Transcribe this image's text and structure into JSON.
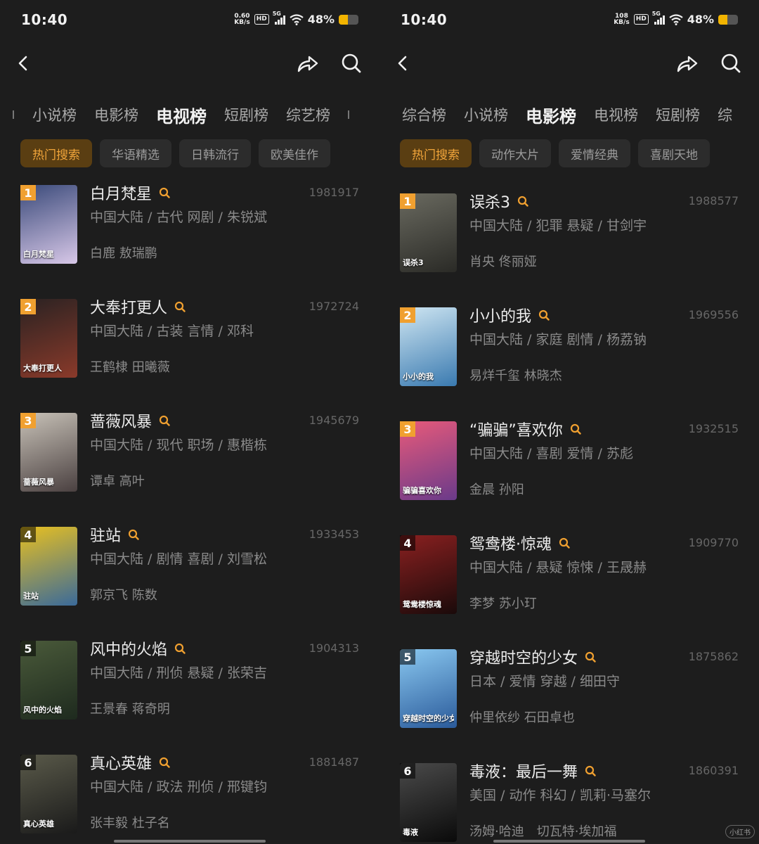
{
  "colors": {
    "accent": "#f0a030",
    "background": "#1d1d1d",
    "chip_active_bg": "#5a3e12"
  },
  "left": {
    "status": {
      "time": "10:40",
      "speed_value": "0.60",
      "speed_unit": "KB/s",
      "hd": "HD",
      "network": "5G",
      "battery_pct": "48%",
      "battery_level": 0.48
    },
    "tabs": [
      {
        "label": "小说榜",
        "active": false
      },
      {
        "label": "电影榜",
        "active": false
      },
      {
        "label": "电视榜",
        "active": true
      },
      {
        "label": "短剧榜",
        "active": false
      },
      {
        "label": "综艺榜",
        "active": false
      }
    ],
    "subtabs": [
      {
        "label": "热门搜索",
        "active": true
      },
      {
        "label": "华语精选",
        "active": false
      },
      {
        "label": "日韩流行",
        "active": false
      },
      {
        "label": "欧美佳作",
        "active": false
      }
    ],
    "items": [
      {
        "rank": "1",
        "title": "白月梵星",
        "score": "1981917",
        "meta": "中国大陆 / 古代 网剧 / 朱锐斌",
        "cast": "白鹿 敖瑞鹏",
        "poster_text": "白月梵星",
        "c1": "#3a4a7a",
        "c2": "#d8c8e8"
      },
      {
        "rank": "2",
        "title": "大奉打更人",
        "score": "1972724",
        "meta": "中国大陆 / 古装 言情 / 邓科",
        "cast": "王鹤棣 田曦薇",
        "poster_text": "大奉打更人",
        "c1": "#2a2222",
        "c2": "#8a3a2a"
      },
      {
        "rank": "3",
        "title": "蔷薇风暴",
        "score": "1945679",
        "meta": "中国大陆 / 现代 职场 / 惠楷栋",
        "cast": "谭卓 高叶",
        "poster_text": "蔷薇风暴",
        "c1": "#c8c2b8",
        "c2": "#4a4040"
      },
      {
        "rank": "4",
        "title": "驻站",
        "score": "1933453",
        "meta": "中国大陆 / 剧情 喜剧 / 刘雪松",
        "cast": "郭京飞 陈数",
        "poster_text": "驻站",
        "c1": "#e8c020",
        "c2": "#3a6a9a"
      },
      {
        "rank": "5",
        "title": "风中的火焰",
        "score": "1904313",
        "meta": "中国大陆 / 刑侦 悬疑 / 张荣吉",
        "cast": "王景春 蒋奇明",
        "poster_text": "风中的火焰",
        "c1": "#4a5a3a",
        "c2": "#1e2a1e"
      },
      {
        "rank": "6",
        "title": "真心英雄",
        "score": "1881487",
        "meta": "中国大陆 / 政法 刑侦 / 邢键钧",
        "cast": "张丰毅 杜子名",
        "poster_text": "真心英雄",
        "c1": "#5a5a4a",
        "c2": "#1a1a1a"
      }
    ]
  },
  "right": {
    "status": {
      "time": "10:40",
      "speed_value": "108",
      "speed_unit": "KB/s",
      "hd": "HD",
      "network": "5G",
      "battery_pct": "48%",
      "battery_level": 0.48
    },
    "tabs": [
      {
        "label": "综合榜",
        "active": false
      },
      {
        "label": "小说榜",
        "active": false
      },
      {
        "label": "电影榜",
        "active": true
      },
      {
        "label": "电视榜",
        "active": false
      },
      {
        "label": "短剧榜",
        "active": false
      },
      {
        "label": "综",
        "active": false
      }
    ],
    "subtabs": [
      {
        "label": "热门搜索",
        "active": true
      },
      {
        "label": "动作大片",
        "active": false
      },
      {
        "label": "爱情经典",
        "active": false
      },
      {
        "label": "喜剧天地",
        "active": false
      }
    ],
    "items": [
      {
        "rank": "1",
        "title": "误杀3",
        "score": "1988577",
        "meta": "中国大陆 / 犯罪 悬疑 / 甘剑宇",
        "cast": "肖央 佟丽娅",
        "poster_text": "误杀3",
        "c1": "#6a6a60",
        "c2": "#2a2a26"
      },
      {
        "rank": "2",
        "title": "小小的我",
        "score": "1969556",
        "meta": "中国大陆 / 家庭 剧情 / 杨荔钠",
        "cast": "易烊千玺 林晓杰",
        "poster_text": "小小的我",
        "c1": "#cfe6f2",
        "c2": "#3a7ab0"
      },
      {
        "rank": "3",
        "title": "“骗骗”喜欢你",
        "score": "1932515",
        "meta": "中国大陆 / 喜剧 爱情 / 苏彪",
        "cast": "金晨 孙阳",
        "poster_text": "骗骗喜欢你",
        "c1": "#e85a7a",
        "c2": "#6a3a8a"
      },
      {
        "rank": "4",
        "title": "鸳鸯楼·惊魂",
        "score": "1909770",
        "meta": "中国大陆 / 悬疑 惊悚 / 王晟赫",
        "cast": "李梦 苏小玎",
        "poster_text": "鸳鸯楼惊魂",
        "c1": "#8a2020",
        "c2": "#1a0a0a"
      },
      {
        "rank": "5",
        "title": "穿越时空的少女",
        "score": "1875862",
        "meta": "日本 / 爱情 穿越 / 细田守",
        "cast": "仲里依纱 石田卓也",
        "poster_text": "穿越时空的少女",
        "c1": "#8ac8f0",
        "c2": "#2a5a9a"
      },
      {
        "rank": "6",
        "title": "毒液：最后一舞",
        "score": "1860391",
        "meta": "美国 / 动作 科幻 / 凯莉·马塞尔",
        "cast": "汤姆·哈迪　切瓦特·埃加福",
        "poster_text": "毒液",
        "c1": "#4a4a4a",
        "c2": "#0a0a0a"
      }
    ]
  },
  "watermark": "小红书"
}
